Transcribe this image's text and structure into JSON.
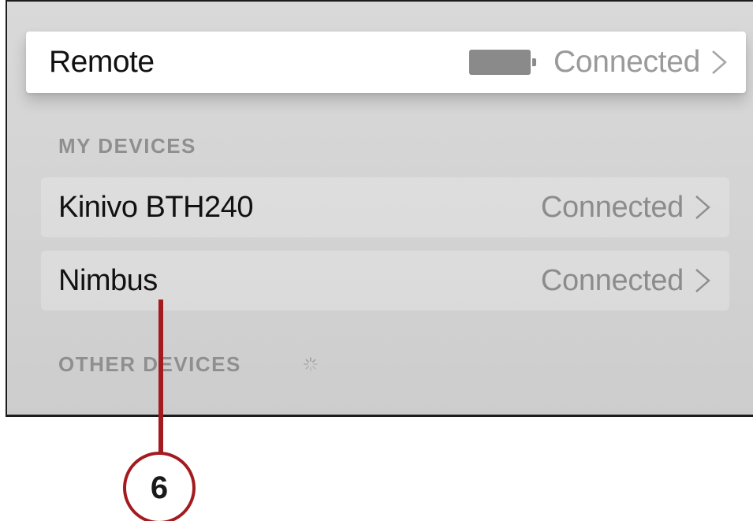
{
  "remote": {
    "label": "Remote",
    "status": "Connected",
    "battery_icon": "battery-icon",
    "chevron_icon": "chevron-right-icon"
  },
  "sections": {
    "my_devices": "MY DEVICES",
    "other_devices": "OTHER DEVICES",
    "spinner_icon": "loading-spinner-icon"
  },
  "devices": [
    {
      "label": "Kinivo BTH240",
      "status": "Connected"
    },
    {
      "label": "Nimbus",
      "status": "Connected"
    }
  ],
  "callout": {
    "number": "6",
    "color": "#a31a1f"
  }
}
